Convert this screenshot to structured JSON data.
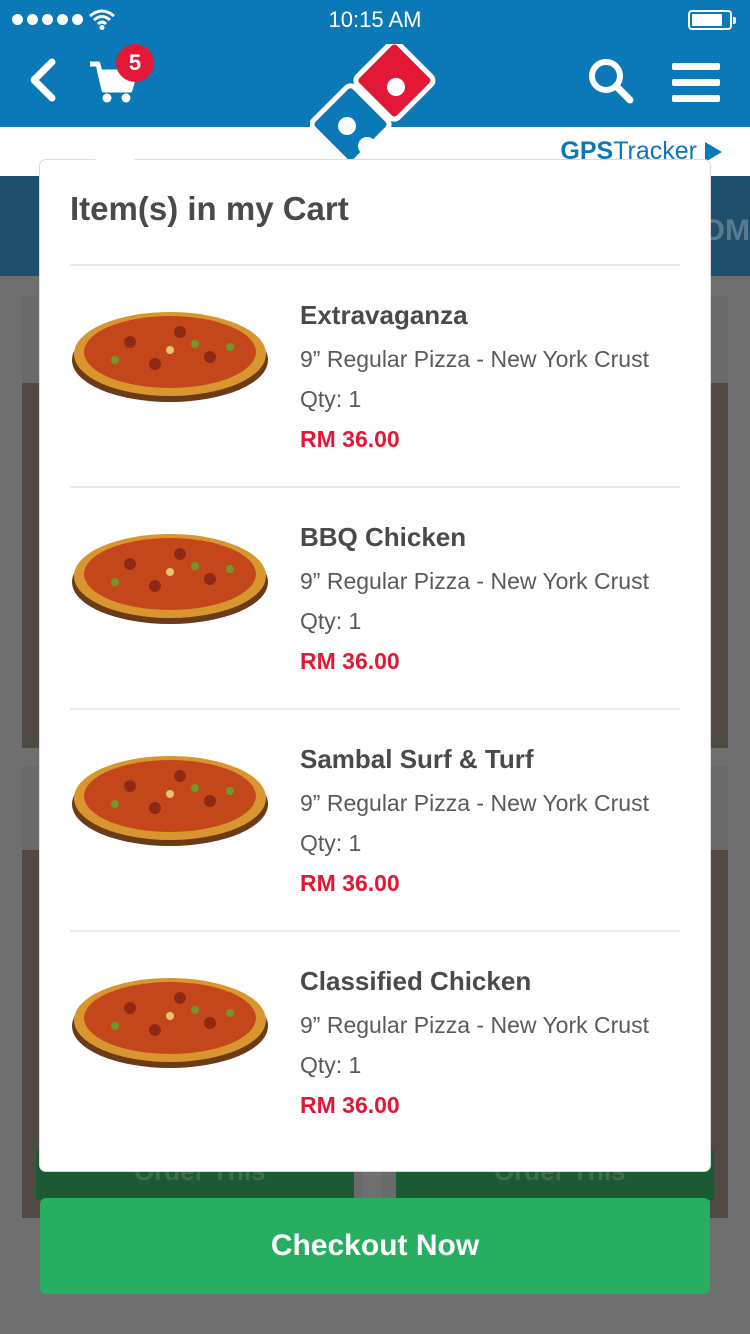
{
  "status_bar": {
    "time": "10:15 AM"
  },
  "header": {
    "cart_count": "5"
  },
  "subbar": {
    "gps_bold": "GPS",
    "gps_rest": "Tracker"
  },
  "background": {
    "order_label": "Order This"
  },
  "cart_popup": {
    "title": "Item(s) in my Cart",
    "items": [
      {
        "name": "Extravaganza",
        "description": "9” Regular Pizza - New York Crust",
        "qty": "Qty: 1",
        "price": "RM 36.00"
      },
      {
        "name": "BBQ Chicken",
        "description": "9” Regular Pizza - New York Crust",
        "qty": "Qty: 1",
        "price": "RM 36.00"
      },
      {
        "name": "Sambal Surf & Turf",
        "description": "9” Regular Pizza - New York Crust",
        "qty": "Qty: 1",
        "price": "RM 36.00"
      },
      {
        "name": "Classified Chicken",
        "description": "9” Regular Pizza - New York Crust",
        "qty": "Qty: 1",
        "price": "RM 36.00"
      }
    ]
  },
  "checkout": {
    "label": "Checkout Now"
  },
  "colors": {
    "brand_blue": "#0b78b7",
    "brand_red": "#e31837",
    "checkout_green": "#27ae60"
  }
}
